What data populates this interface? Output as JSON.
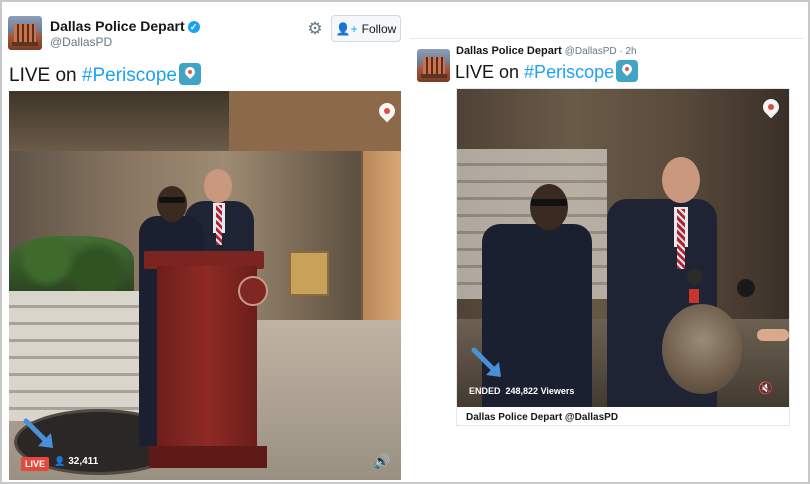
{
  "colors": {
    "accent": "#1da1f2",
    "live": "#e5483c",
    "arrow": "#4a90d9"
  },
  "left_tweet": {
    "name": "Dallas Police Depart",
    "handle": "@DallasPD",
    "verified": true,
    "follow_label": "Follow",
    "text_prefix": "LIVE on ",
    "hashtag": "#Periscope",
    "video": {
      "live_badge": "LIVE",
      "viewers": "32,411",
      "icons": [
        "periscope-icon",
        "volume-icon",
        "user-icon"
      ]
    }
  },
  "right_tweet": {
    "name": "Dallas Police Depart",
    "handle_time": "@DallasPD · 2h",
    "text_prefix": "LIVE on ",
    "hashtag": "#Periscope",
    "video": {
      "status": "ENDED",
      "viewers": "248,822 Viewers"
    },
    "card_footer": "Dallas Police Depart @DallasPD"
  }
}
